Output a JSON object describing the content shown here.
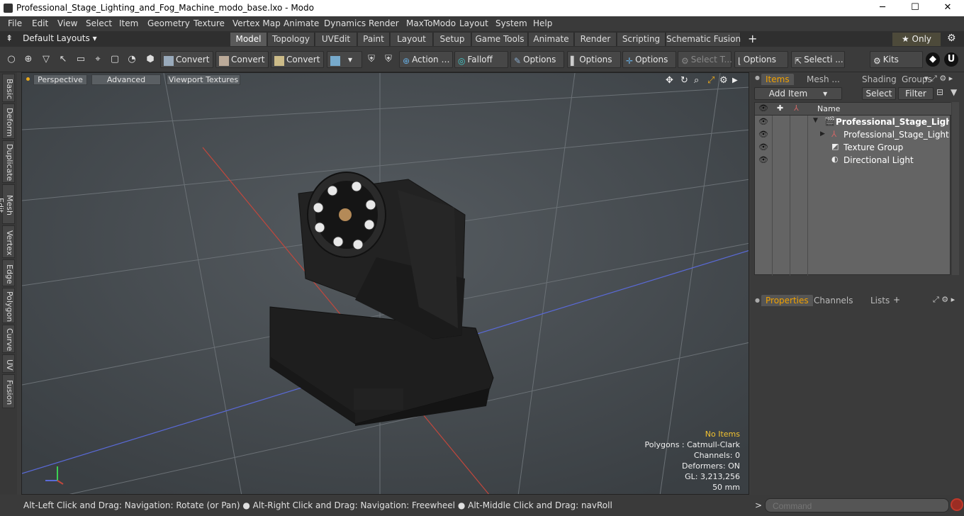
{
  "window": {
    "title": "Professional_Stage_Lighting_and_Fog_Machine_modo_base.lxo - Modo",
    "minimize": "─",
    "maximize": "☐",
    "close": "✕"
  },
  "menu": [
    "File",
    "Edit",
    "View",
    "Select",
    "Item",
    "Geometry",
    "Texture",
    "Vertex Map",
    "Animate",
    "Dynamics",
    "Render",
    "MaxToModo",
    "Layout",
    "System",
    "Help"
  ],
  "layouts": {
    "label": "Default Layouts ▾"
  },
  "tabs": [
    "Model",
    "Topology",
    "UVEdit",
    "Paint",
    "Layout",
    "Setup",
    "Game Tools",
    "Animate",
    "Render",
    "Scripting",
    "Schematic Fusion"
  ],
  "active_tab": "Model",
  "only_label": "★  Only",
  "toolbar": {
    "convert1": "Convert",
    "convert2": "Convert",
    "convert3": "Convert",
    "action": "Action  …",
    "falloff": "Falloff",
    "options1": "Options",
    "options2": "Options",
    "options3": "Options",
    "select_t": "Select T...",
    "options4": "Options",
    "selecti": "Selecti ...",
    "kits": "Kits"
  },
  "left_tabs": [
    "Basic",
    "Deform",
    "Duplicate",
    "Mesh Edit",
    "Vertex",
    "Edge",
    "Polygon",
    "Curve",
    "UV",
    "Fusion"
  ],
  "viewport": {
    "perspective": "Perspective",
    "advanced": "Advanced",
    "viewport_textures": "Viewport Textures",
    "info": {
      "no_items": "No Items",
      "polygons": "Polygons : Catmull-Clark",
      "channels": "Channels: 0",
      "deformers": "Deformers: ON",
      "gl": "GL: 3,213,256",
      "scale": "50 mm"
    }
  },
  "status": "Alt-Left Click and Drag: Navigation: Rotate (or Pan) ● Alt-Right Click and Drag: Navigation: Freewheel ● Alt-Middle Click and Drag: navRoll",
  "items_panel": {
    "tabs": [
      "Items",
      "Mesh ...",
      "Shading",
      "Groups"
    ],
    "add_item": "Add Item",
    "select": "Select",
    "filter": "Filter",
    "name_header": "Name",
    "rows": [
      {
        "label": "Professional_Stage_Lighti..."
      },
      {
        "label": "Professional_Stage_Lighting ..."
      },
      {
        "label": "Texture Group"
      },
      {
        "label": "Directional Light"
      }
    ]
  },
  "props_panel": {
    "tabs": [
      "Properties",
      "Channels",
      "Lists"
    ],
    "plus": "+"
  },
  "command": {
    "placeholder": "Command",
    "prompt": ">"
  }
}
